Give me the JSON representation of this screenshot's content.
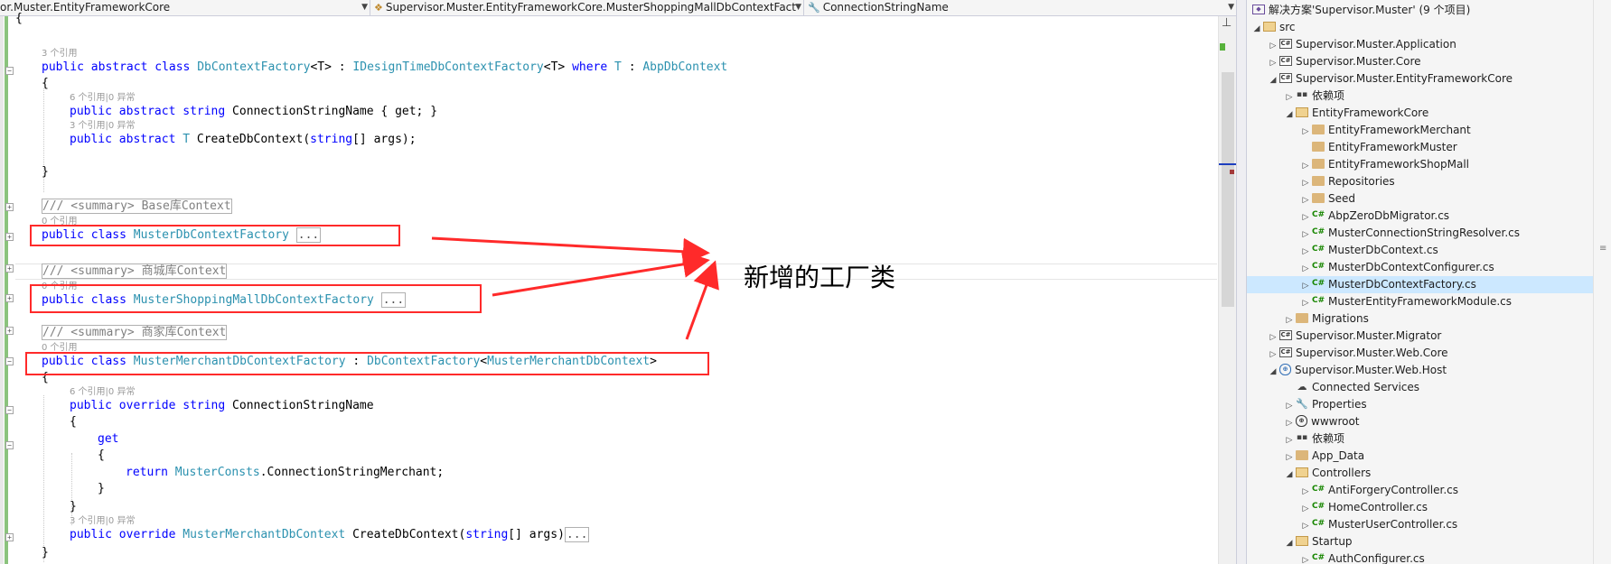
{
  "nav": {
    "project": "or.Muster.EntityFrameworkCore",
    "type": "Supervisor.Muster.EntityFrameworkCore.MusterShoppingMallDbContextFact",
    "member": "ConnectionStringName"
  },
  "code": {
    "open_brace": "{",
    "lens_dbcf": "3 个引用",
    "kw_public": "public",
    "kw_abstract": "abstract",
    "kw_class": "class",
    "kw_where": "where",
    "kw_string": "string",
    "kw_get": "get",
    "kw_override": "override",
    "kw_return": "return",
    "dbcf_name": "DbContextFactory",
    "tparam": "<T>",
    "colon": ":",
    "idtf": "IDesignTimeDbContextFactory",
    "t": "T",
    "abpdbcontext": "AbpDbContext",
    "brace_open": "{",
    "brace_close": "}",
    "lens_connstr": "6 个引用|0 异常",
    "connstr_name": "ConnectionStringName",
    "get_block": "{ get; }",
    "lens_create": "3 个引用|0 异常",
    "createdb_name": "CreateDbContext",
    "args_open": "(",
    "args_close": "[] args);",
    "comment_base": "/// <summary> Base库Context",
    "lens_zero": "0 个引用",
    "muster_factory": "MusterDbContextFactory",
    "ellipsis": "...",
    "comment_mall": "/// <summary> 商城库Context",
    "mall_factory": "MusterShoppingMallDbContextFactory",
    "comment_merchant": "/// <summary> 商家库Context",
    "merchant_factory": "MusterMerchantDbContextFactory",
    "merchant_ctx": "MusterMerchantDbContext",
    "lt": "<",
    "gt": ">",
    "muster_consts": "MusterConsts",
    "conn_merchant": ".ConnectionStringMerchant;",
    "args_close2": "[] args)"
  },
  "callout": "新增的工厂类",
  "solution": {
    "root": "解决方案'Supervisor.Muster' (9 个项目)",
    "nodes": [
      "src",
      "Supervisor.Muster.Application",
      "Supervisor.Muster.Core",
      "Supervisor.Muster.EntityFrameworkCore",
      "依赖项",
      "EntityFrameworkCore",
      "EntityFrameworkMerchant",
      "EntityFrameworkMuster",
      "EntityFrameworkShopMall",
      "Repositories",
      "Seed",
      "AbpZeroDbMigrator.cs",
      "MusterConnectionStringResolver.cs",
      "MusterDbContext.cs",
      "MusterDbContextConfigurer.cs",
      "MusterDbContextFactory.cs",
      "MusterEntityFrameworkModule.cs",
      "Migrations",
      "Supervisor.Muster.Migrator",
      "Supervisor.Muster.Web.Core",
      "Supervisor.Muster.Web.Host",
      "Connected Services",
      "Properties",
      "wwwroot",
      "依赖项",
      "App_Data",
      "Controllers",
      "AntiForgeryController.cs",
      "HomeController.cs",
      "MusterUserController.cs",
      "Startup",
      "AuthConfigurer.cs"
    ],
    "selected": "MusterDbContextFactory.cs"
  },
  "icons": {
    "dropdown": "chevron-down-icon",
    "project": "csharp-project-icon",
    "cs_file": "csharp-file-icon",
    "folder": "folder-icon",
    "references": "references-icon",
    "web_project": "web-project-icon"
  },
  "colors": {
    "keyword": "#0000ff",
    "type": "#2b91af",
    "comment": "#808080",
    "highlight_box": "#ff2a2a",
    "changed_line": "#57b23b",
    "selection": "#cce8ff"
  }
}
